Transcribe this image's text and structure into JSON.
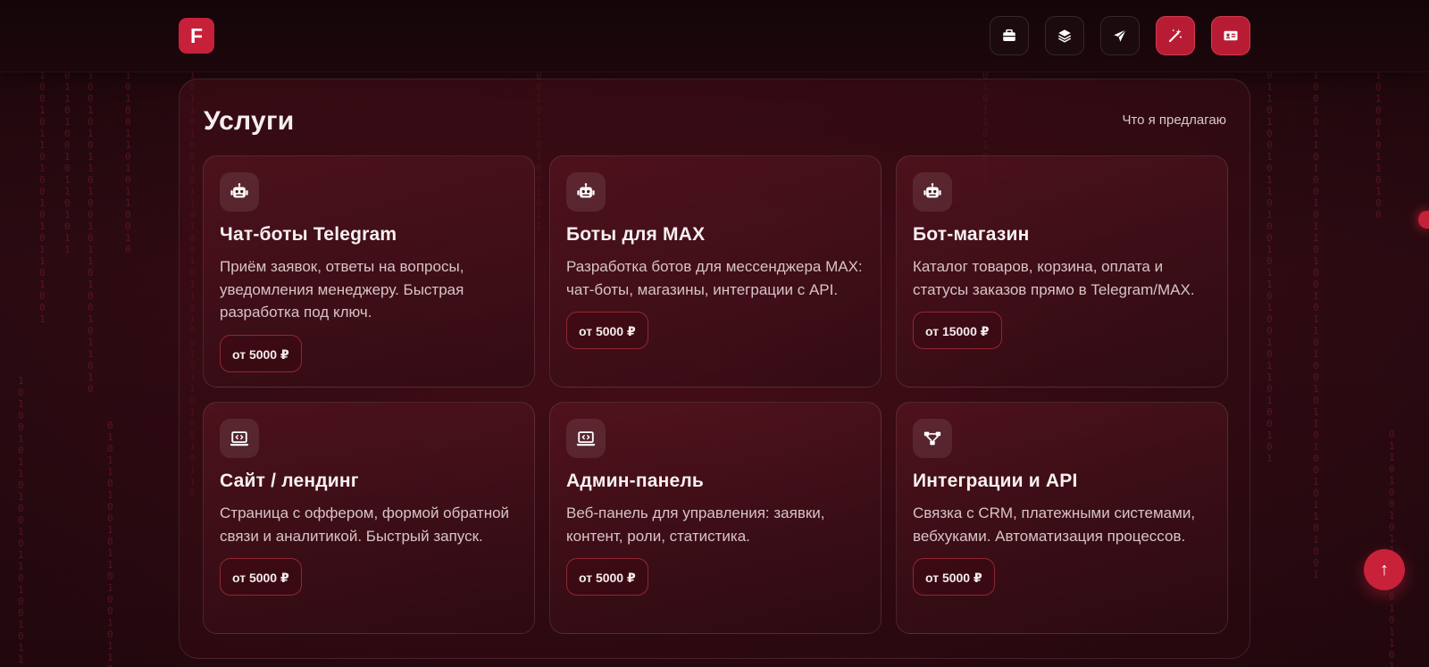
{
  "header": {
    "logo_letter": "F",
    "nav": [
      {
        "icon": "briefcase-icon",
        "active": false
      },
      {
        "icon": "layers-icon",
        "active": false
      },
      {
        "icon": "paper-plane-icon",
        "active": false
      },
      {
        "icon": "magic-wand-icon",
        "active": true
      },
      {
        "icon": "id-card-icon",
        "active": true
      }
    ]
  },
  "services": {
    "title": "Услуги",
    "subtitle": "Что я предлагаю",
    "cards": [
      {
        "icon": "robot-icon",
        "title": "Чат-боты Telegram",
        "description": "Приём заявок, ответы на вопросы, уведомления менеджеру. Быстрая разработка под ключ.",
        "price": "от 5000 ₽"
      },
      {
        "icon": "robot-icon",
        "title": "Боты для MAX",
        "description": "Разработка ботов для мессенджера MAX: чат-боты, магазины, интеграции с API.",
        "price": "от 5000 ₽"
      },
      {
        "icon": "robot-icon",
        "title": "Бот-магазин",
        "description": "Каталог товаров, корзина, оплата и статусы заказов прямо в Telegram/MAX.",
        "price": "от 15000 ₽"
      },
      {
        "icon": "laptop-code-icon",
        "title": "Сайт / лендинг",
        "description": "Страница с оффером, формой обратной связи и аналитикой. Быстрый запуск.",
        "price": "от 5000 ₽"
      },
      {
        "icon": "laptop-code-icon",
        "title": "Админ-панель",
        "description": "Веб-панель для управления: заявки, контент, роли, статистика.",
        "price": "от 5000 ₽"
      },
      {
        "icon": "network-icon",
        "title": "Интеграции и API",
        "description": "Связка с CRM, платежными системами, вебхуками. Автоматизация процессов.",
        "price": "от 5000 ₽"
      }
    ]
  },
  "scroll_top": {
    "label": "↑"
  },
  "colors": {
    "accent": "#c7213a",
    "background": "#1a070b"
  }
}
